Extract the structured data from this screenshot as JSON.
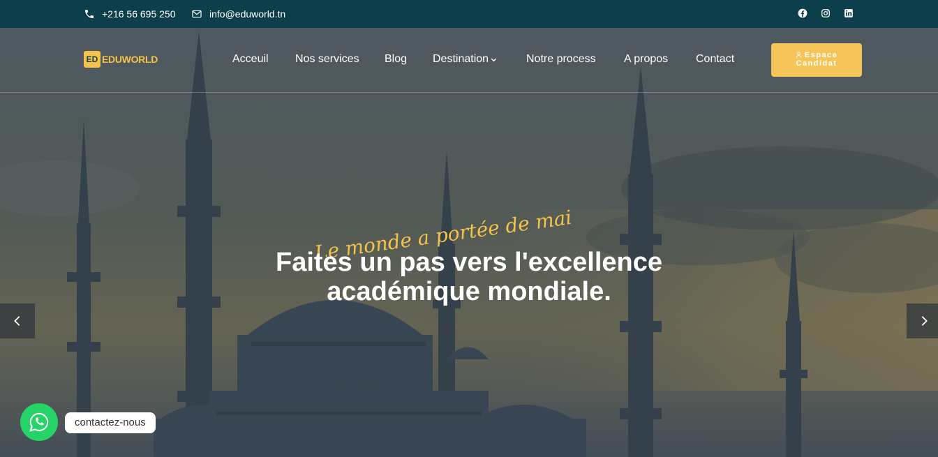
{
  "topbar": {
    "phone": "+216 56 695 250",
    "email": "info@eduworld.tn",
    "socials": [
      "facebook-icon",
      "instagram-icon",
      "linkedin-icon"
    ]
  },
  "brand": {
    "logo_mark": "ED",
    "name": "EDUWORLD",
    "accent_color": "#f5c349",
    "topbar_color": "#0d3f4b"
  },
  "nav": {
    "items": [
      {
        "label": "Acceuil"
      },
      {
        "label": "Nos services"
      },
      {
        "label": "Blog"
      },
      {
        "label": "Destination",
        "has_dropdown": true
      },
      {
        "label": "Notre process"
      },
      {
        "label": "A propos"
      },
      {
        "label": "Contact"
      }
    ],
    "cta_line1": "Espace",
    "cta_line2": "Candidat"
  },
  "hero": {
    "script_text": "Le monde a portée de mai",
    "headline_line1": "Faites un pas vers l'excellence",
    "headline_line2": "académique mondiale."
  },
  "whatsapp": {
    "label": "contactez-nous",
    "color": "#25d366"
  }
}
